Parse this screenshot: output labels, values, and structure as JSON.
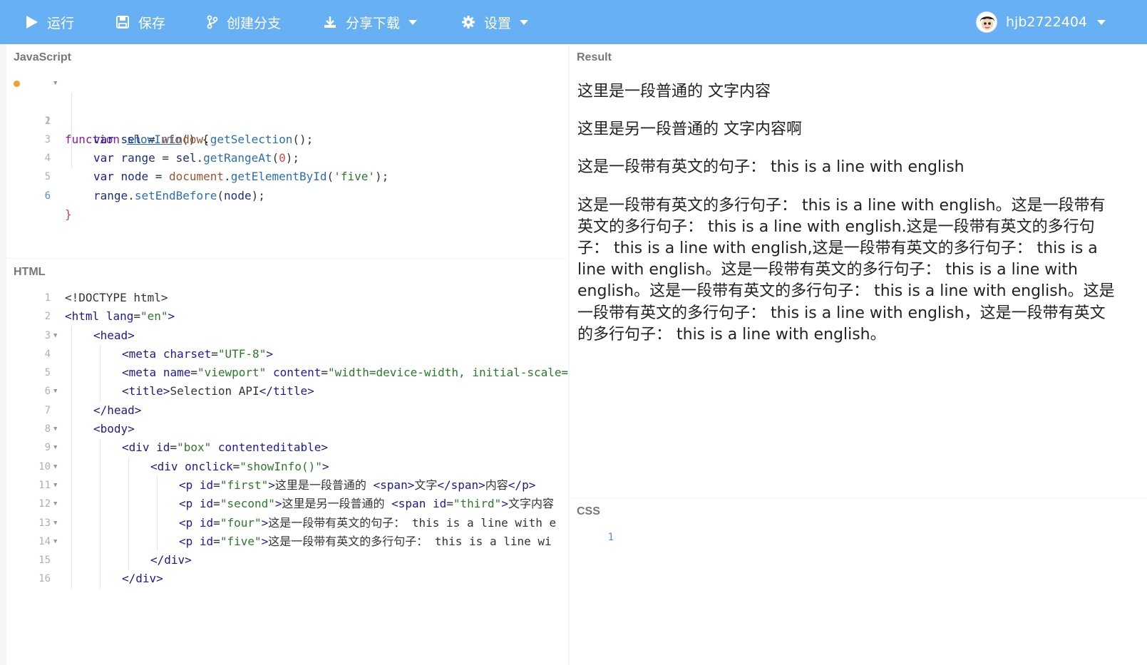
{
  "topbar": {
    "run_label": "运行",
    "save_label": "保存",
    "branch_label": "创建分支",
    "share_label": "分享下载",
    "settings_label": "设置",
    "username": "hjb2722404"
  },
  "panels": {
    "js_title": "JavaScript",
    "html_title": "HTML",
    "result_title": "Result",
    "css_title": "CSS"
  },
  "js_code": {
    "l1": "function showInfo() {",
    "l2": "var sel = window.getSelection();",
    "l3": "var range = sel.getRangeAt(0);",
    "l4": "var node = document.getElementById('five');",
    "l5": "range.setEndBefore(node);",
    "l6": "}"
  },
  "html_code": {
    "l1": "<!DOCTYPE html>",
    "l2": "<html lang=\"en\">",
    "l3": "<head>",
    "l4": "<meta charset=\"UTF-8\">",
    "l5": "<meta name=\"viewport\" content=\"width=device-width, initial-scale=",
    "l6": "<title>Selection API</title>",
    "l7": "</head>",
    "l8": "<body>",
    "l9": "<div id=\"box\" contenteditable>",
    "l10": "<div onclick=\"showInfo()\">",
    "l11": "<p id=\"first\">这里是一段普通的 <span>文字</span>内容</p>",
    "l12": "<p id=\"second\">这里是另一段普通的 <span id=\"third\">文字内容",
    "l13": "<p id=\"four\">这是一段带有英文的句子： this is a line with e",
    "l14": "<p id=\"five\">这是一段带有英文的多行句子： this is a line wi",
    "l15": "</div>",
    "l16": "</div>"
  },
  "result": {
    "p1": "这里是一段普通的 文字内容",
    "p2": "这里是另一段普通的 文字内容啊",
    "p3": "这是一段带有英文的句子： this is a line with english",
    "p4": "这是一段带有英文的多行句子： this is a line with english。这是一段带有英文的多行句子： this is a line with english.这是一段带有英文的多行句子： this is a line with english,这是一段带有英文的多行句子： this is a line with english。这是一段带有英文的多行句子： this is a line with english。这是一段带有英文的多行句子： this is a line with english。这是一段带有英文的多行句子： this is a line with english，这是一段带有英文的多行句子： this is a line with english。"
  },
  "colors": {
    "topbar": "#68b0f4",
    "marker": "#f0a030"
  }
}
